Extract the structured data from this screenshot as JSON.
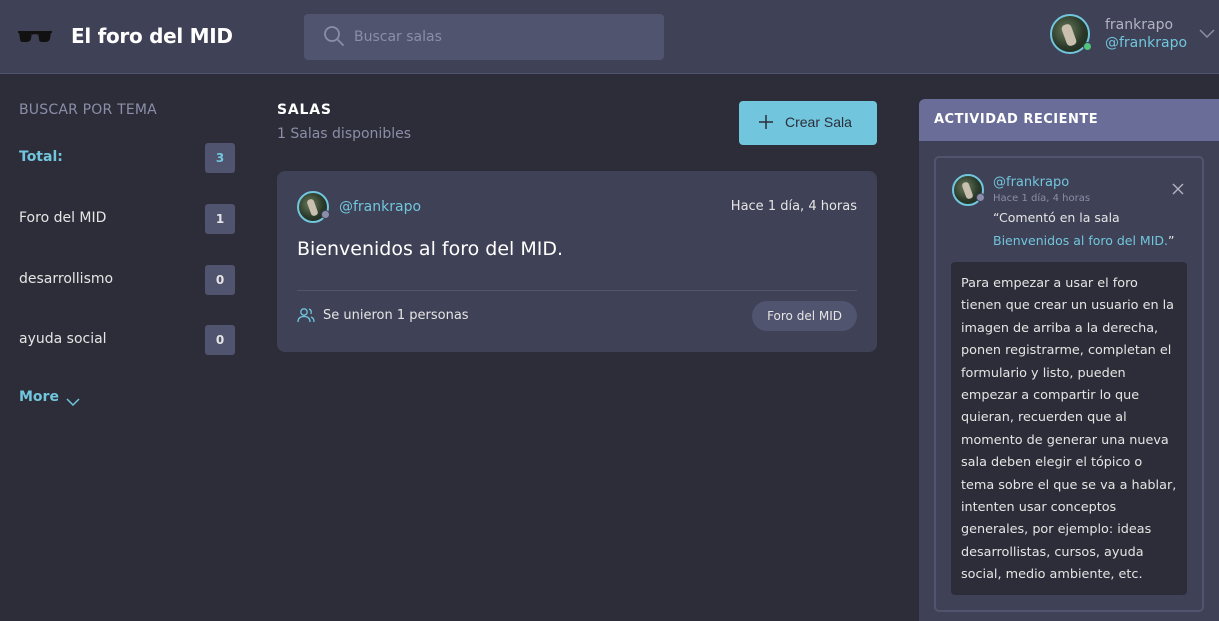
{
  "header": {
    "brand": "El foro del MID",
    "search": {
      "placeholder": "Buscar salas"
    },
    "user": {
      "name": "frankrapo",
      "handle": "@frankrapo"
    }
  },
  "topics": {
    "title": "BUSCAR POR TEMA",
    "items": [
      {
        "label": "Total:",
        "count": "3"
      },
      {
        "label": "Foro del MID",
        "count": "1"
      },
      {
        "label": "desarrollismo",
        "count": "0"
      },
      {
        "label": "ayuda social",
        "count": "0"
      }
    ],
    "more_label": "More"
  },
  "rooms": {
    "title": "SALAS",
    "subtitle": "1 Salas disponibles",
    "create_label": "Crear Sala",
    "list": [
      {
        "host": "@frankrapo",
        "time": "Hace 1 día, 4 horas",
        "name": "Bienvenidos al foro del MID.",
        "joined": "Se unieron 1 personas",
        "topic": "Foro del MID"
      }
    ]
  },
  "activity": {
    "title": "ACTIVIDAD RECIENTE",
    "items": [
      {
        "handle": "@frankrapo",
        "time": "Hace 1 día, 4 horas",
        "comment_prefix": "“Comentó en la sala",
        "room_link": "Bienvenidos al foro del MID.",
        "comment_suffix": "”",
        "message": "Para empezar a usar el foro tienen que crear un usuario en la imagen de arriba a la derecha, ponen registrarme, completan el formulario y listo, pueden empezar a compartir lo que quieran, recuerden que al momento de generar una nueva sala deben elegir el tópico o tema sobre el que se va a hablar, intenten usar conceptos generales, por ejemplo: ideas desarrollistas, cursos, ayuda social, medio ambiente, etc."
      }
    ]
  },
  "colors": {
    "accent": "#71c6dd",
    "background": "#2d2d39",
    "surface": "#3f4156",
    "surface_light": "#51546e",
    "panel_header": "#696d97",
    "online": "#51c57c"
  },
  "icons": {
    "logo": "glasses-icon",
    "search": "search-icon",
    "user_menu": "chevron-down-icon",
    "more": "chevron-down-icon",
    "create": "plus-icon",
    "joined": "users-icon",
    "close": "close-icon"
  }
}
